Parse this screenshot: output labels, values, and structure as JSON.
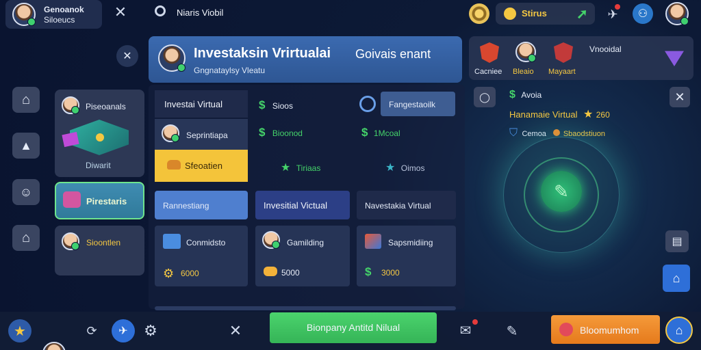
{
  "top": {
    "profile_line1": "Genoanok",
    "profile_line2": "Siloeucs",
    "tab_label": "Niaris Viobil",
    "coin_label": "Stirus"
  },
  "left_nav": {
    "items": [
      "home",
      "hat",
      "face",
      "home"
    ]
  },
  "categories": {
    "c1": "Piseoanals",
    "c1_sub": "Diwarit",
    "c2": "Pirestaris",
    "c3": "Sioontlen"
  },
  "header": {
    "title": "Investaksin Vrirtualai",
    "title_suffix": "Goivais enant",
    "subtitle": "Gngnataylsy Vleatu"
  },
  "grid": {
    "left_menu": {
      "title": "Investai Virtual",
      "item": "Seprintiapa",
      "button": "Sfeoatien"
    },
    "stats": [
      {
        "label": "Sioos"
      },
      {
        "label": "Bioonod"
      },
      {
        "label": "Tiriaas"
      }
    ],
    "stats_right": [
      {
        "label": "Fangestaoilk"
      },
      {
        "label": "1Mcoal"
      },
      {
        "label": "Oimos"
      }
    ],
    "tabs": [
      "Rannestiang",
      "Invesitial Victual",
      "Navestakia Virtual"
    ],
    "cards": [
      {
        "title": "Conmidsto",
        "value": "6000"
      },
      {
        "title": "Gamilding",
        "value": "5000"
      },
      {
        "title": "Sapsmidiing",
        "value": "3000"
      }
    ]
  },
  "right": {
    "badges": [
      "Cacniee",
      "Bleaio",
      "Mayaart"
    ],
    "badge_title": "Vnooidal",
    "line1": "Avoia",
    "line2": "Hanamaie Virtual",
    "line2_value": "260",
    "line3a": "Cemoa",
    "line3b": "Sbaodstiuon"
  },
  "bottom": {
    "primary": "Bionpany Antitd Nilual",
    "cta": "Bloomumhom"
  },
  "colors": {
    "accent_green": "#3fbd5f",
    "cta_orange": "#f08a2a",
    "yellow": "#f5c842",
    "blue": "#2e6fd8"
  }
}
